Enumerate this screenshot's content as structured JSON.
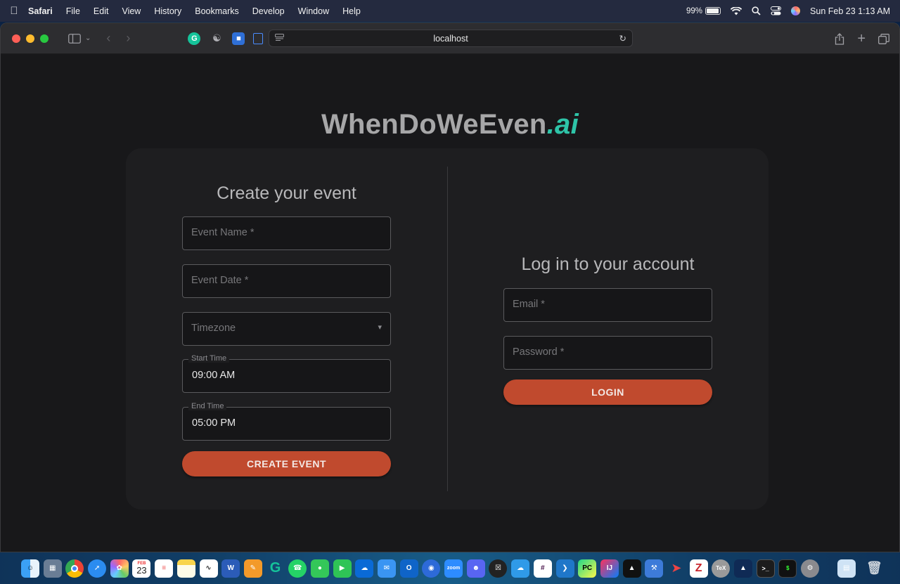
{
  "menubar": {
    "app": "Safari",
    "items": [
      "File",
      "Edit",
      "View",
      "History",
      "Bookmarks",
      "Develop",
      "Window",
      "Help"
    ],
    "battery": "99%",
    "datetime": "Sun Feb 23  1:13 AM"
  },
  "browser": {
    "url": "localhost"
  },
  "page": {
    "brand_main": "WhenDoWeEven",
    "brand_suffix": ".ai",
    "create": {
      "title": "Create your event",
      "event_name_placeholder": "Event Name *",
      "event_date_placeholder": "Event Date *",
      "timezone_placeholder": "Timezone",
      "start_time_label": "Start Time",
      "start_time_value": "09:00 AM",
      "end_time_label": "End Time",
      "end_time_value": "05:00 PM",
      "button": "CREATE EVENT"
    },
    "login": {
      "title": "Log in to your account",
      "email_placeholder": "Email *",
      "password_placeholder": "Password *",
      "button": "LOGIN"
    }
  },
  "dock": {
    "calendar_month": "FEB",
    "calendar_day": "23"
  },
  "colors": {
    "accent": "#c04a2e",
    "brand_suffix": "#2ec4a8"
  }
}
